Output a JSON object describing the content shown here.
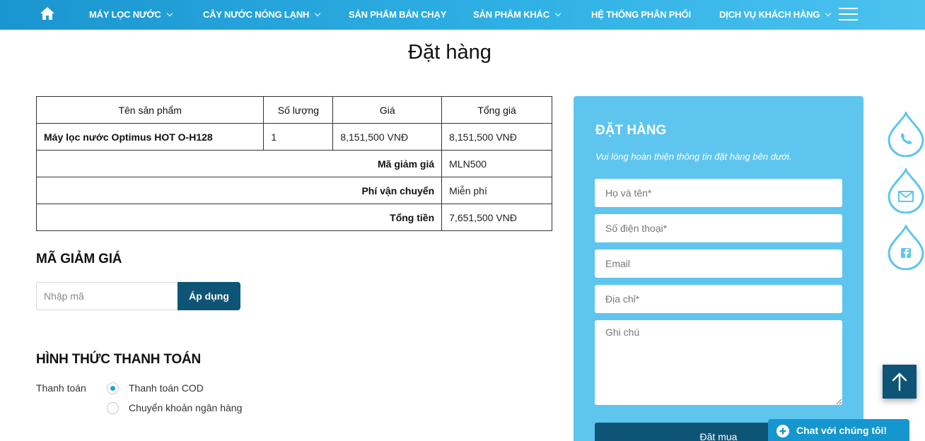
{
  "nav": {
    "home_icon": "home-icon",
    "items": [
      {
        "label": "MÁY LỌC NƯỚC",
        "has_dropdown": true
      },
      {
        "label": "CÂY NƯỚC NÓNG LẠNH",
        "has_dropdown": true
      },
      {
        "label": "SẢN PHẨM BÁN CHẠY",
        "has_dropdown": false
      },
      {
        "label": "SẢN PHẨM KHÁC",
        "has_dropdown": true
      },
      {
        "label": "HỆ THỐNG PHÂN PHỐI",
        "has_dropdown": false
      },
      {
        "label": "DỊCH VỤ KHÁCH HÀNG",
        "has_dropdown": true
      }
    ],
    "menu_icon": "hamburger-menu-icon"
  },
  "page": {
    "title": "Đặt hàng"
  },
  "order_table": {
    "headers": [
      "Tên sản phẩm",
      "Số lượng",
      "Giá",
      "Tổng giá"
    ],
    "items": [
      {
        "name": "Máy lọc nước Optimus HOT O-H128",
        "qty": "1",
        "price": "8,151,500 VNĐ",
        "total": "8,151,500 VNĐ"
      }
    ],
    "summary": [
      {
        "label": "Mã giảm giá",
        "value": "MLN500"
      },
      {
        "label": "Phí vận chuyển",
        "value": "Miễn phí"
      },
      {
        "label": "Tổng tiền",
        "value": "7,651,500 VNĐ"
      }
    ]
  },
  "coupon": {
    "title": "MÃ GIẢM GIÁ",
    "placeholder": "Nhập mã",
    "value": "",
    "button": "Áp dụng"
  },
  "payment": {
    "title": "HÌNH THỨC THANH TOÁN",
    "label": "Thanh toán",
    "options": [
      {
        "label": "Thanh toán COD",
        "selected": true
      },
      {
        "label": "Chuyển khoản ngân hàng",
        "selected": false
      }
    ]
  },
  "order_form": {
    "title": "ĐẶT HÀNG",
    "subtitle": "Vui lòng hoàn thiện thông tin đặt hàng bên dưới.",
    "fields": {
      "name": "Họ và tên*",
      "phone": "Số điện thoại*",
      "email": "Email",
      "address": "Địa chỉ*",
      "note": "Ghi chú"
    },
    "submit": "Đặt mua"
  },
  "floating": {
    "icons": [
      "phone-icon",
      "mail-icon",
      "facebook-icon"
    ],
    "back_to_top_icon": "arrow-up-icon"
  },
  "chat": {
    "label": "Chat với chúng tôi!",
    "icon": "plus-circle-icon"
  },
  "colors": {
    "nav_start": "#1b95cf",
    "nav_end": "#4cc2ef",
    "panel": "#5ec5ee",
    "primary_dark": "#0e5476",
    "radio_accent": "#1ea3dd",
    "chat": "#1696cf"
  }
}
